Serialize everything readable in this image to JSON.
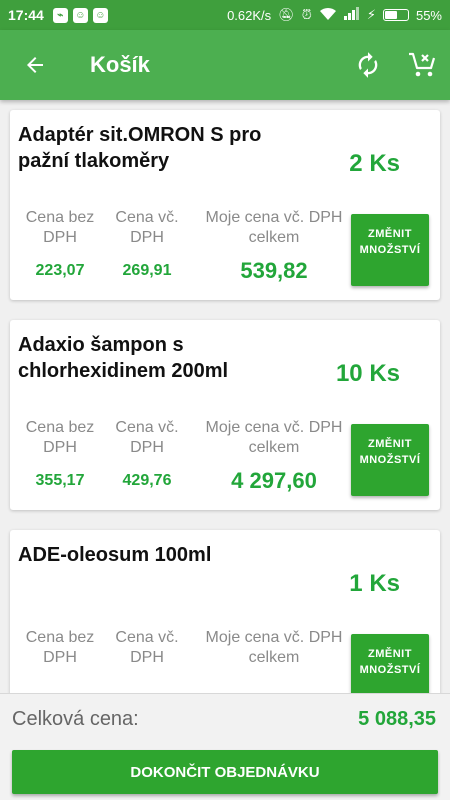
{
  "status_bar": {
    "time": "17:44",
    "app_icons": [
      "messenger-icon",
      "android-icon",
      "android-icon"
    ],
    "speed": "0.62K/s",
    "battery": "55%",
    "battery_level": 0.55
  },
  "app_bar": {
    "title": "Košík"
  },
  "columns": {
    "price_excl": "Cena bez DPH",
    "price_incl": "Cena vč. DPH",
    "my_total": "Moje cena vč. DPH celkem"
  },
  "change_qty_label": "ZMĚNIT MNOŽSTVÍ",
  "items": [
    {
      "name": "Adaptér sit.OMRON S pro pažní tlakoměry",
      "quantity": "2 Ks",
      "price_excl": "223,07",
      "price_incl": "269,91",
      "total": "539,82"
    },
    {
      "name": "Adaxio šampon s chlorhexidinem 200ml",
      "quantity": "10 Ks",
      "price_excl": "355,17",
      "price_incl": "429,76",
      "total": "4 297,60"
    },
    {
      "name": "ADE-oleosum 100ml",
      "quantity": "1 Ks",
      "price_excl": "",
      "price_incl": "",
      "total": ""
    }
  ],
  "footer": {
    "total_label": "Celková cena:",
    "total_value": "5 088,35",
    "finish_button": "DOKONČIT OBJEDNÁVKU"
  },
  "colors": {
    "primary": "#4caf50",
    "status_bar": "#3f9f3d",
    "accent_green": "#22a63a",
    "button_green": "#2ea52f"
  }
}
